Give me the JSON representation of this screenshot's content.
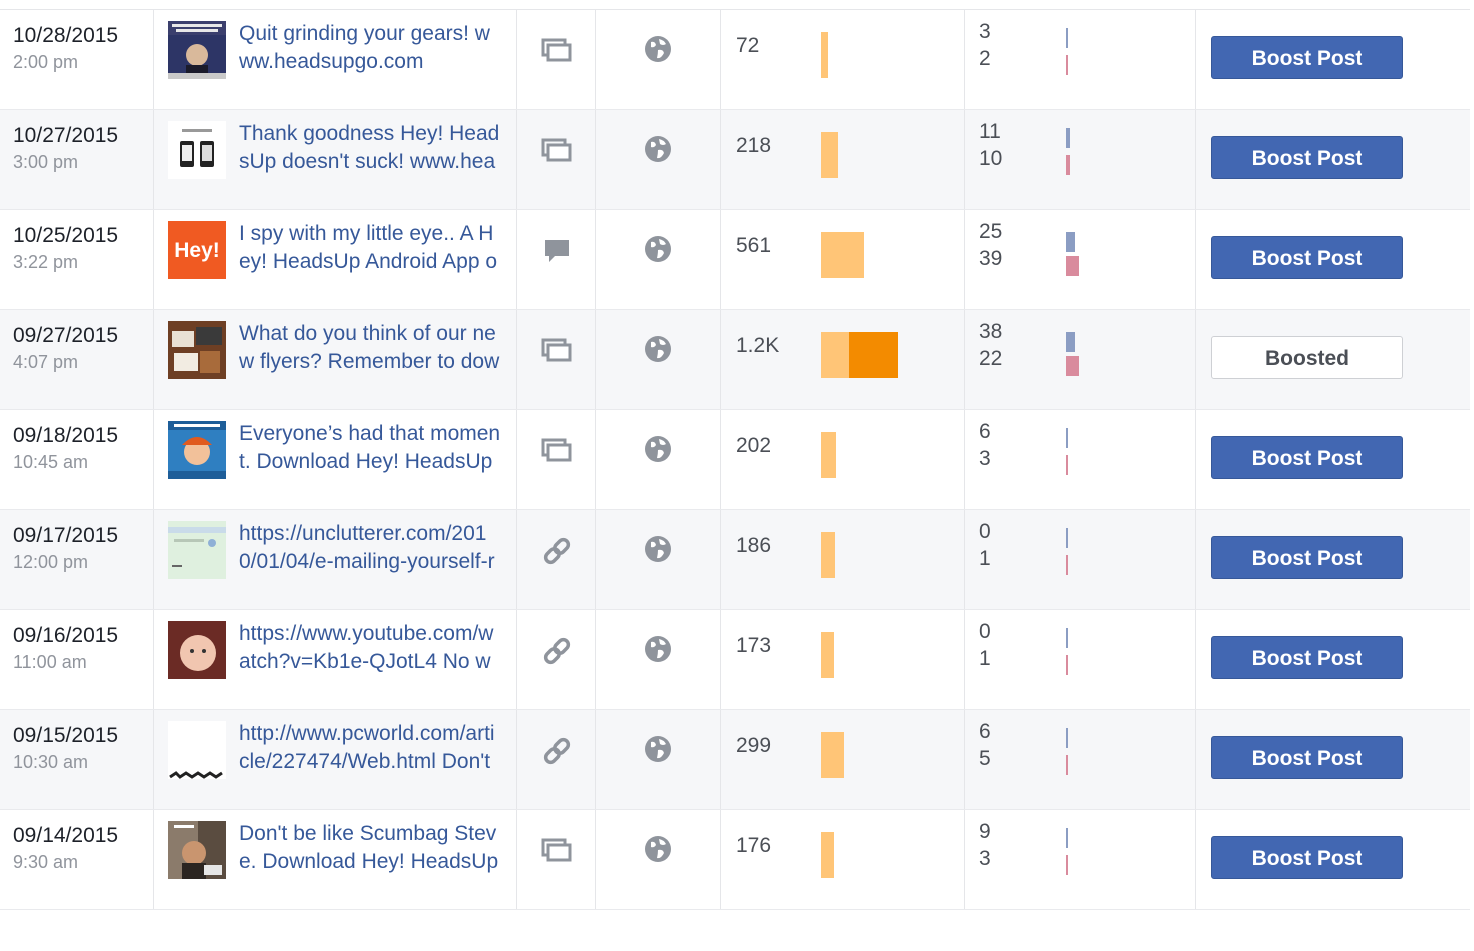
{
  "colors": {
    "link": "#365899",
    "boost_button": "#4267b2",
    "reach_organic": "#ffc577",
    "reach_paid": "#f38b00",
    "engagement_top": "#8b9dc3",
    "engagement_bottom": "#d98b9d"
  },
  "posts": [
    {
      "date": "10/28/2015",
      "time": "2:00 pm",
      "thumb": "meme-dark-thumbnail",
      "line1": "Quit grinding your gears! w",
      "line2": "ww.headsupgo.com",
      "type_icon": "album-icon",
      "target_icon": "globe-icon",
      "reach": "72",
      "reach_organic": 72,
      "reach_paid": 0,
      "eng_top": "3",
      "eng_bottom": "2",
      "eng_top_val": 3,
      "eng_bottom_val": 2,
      "button": "Boost Post",
      "boosted": false
    },
    {
      "date": "10/27/2015",
      "time": "3:00 pm",
      "thumb": "phones-thumbnail",
      "line1": "Thank goodness Hey! Head",
      "line2": "sUp doesn't suck! www.hea",
      "type_icon": "album-icon",
      "target_icon": "globe-icon",
      "reach": "218",
      "reach_organic": 218,
      "reach_paid": 0,
      "eng_top": "11",
      "eng_bottom": "10",
      "eng_top_val": 11,
      "eng_bottom_val": 10,
      "button": "Boost Post",
      "boosted": false
    },
    {
      "date": "10/25/2015",
      "time": "3:22 pm",
      "thumb": "hey-logo-thumbnail",
      "thumb_text": "Hey!",
      "line1": "I spy with my little eye.. A H",
      "line2": "ey! HeadsUp Android App o",
      "type_icon": "status-icon",
      "target_icon": "globe-icon",
      "reach": "561",
      "reach_organic": 561,
      "reach_paid": 0,
      "eng_top": "25",
      "eng_bottom": "39",
      "eng_top_val": 25,
      "eng_bottom_val": 39,
      "button": "Boost Post",
      "boosted": false
    },
    {
      "date": "09/27/2015",
      "time": "4:07 pm",
      "thumb": "flyers-thumbnail",
      "line1": "What do you think of our ne",
      "line2": "w flyers? Remember to dow",
      "type_icon": "album-icon",
      "target_icon": "globe-icon",
      "reach": "1.2K",
      "reach_organic": 430,
      "reach_paid": 770,
      "eng_top": "38",
      "eng_bottom": "22",
      "eng_top_val": 38,
      "eng_bottom_val": 22,
      "button": "Boosted",
      "boosted": true
    },
    {
      "date": "09/18/2015",
      "time": "10:45 am",
      "thumb": "fry-meme-thumbnail",
      "line1": "Everyone’s had that momen",
      "line2": "t. Download Hey! HeadsUp",
      "type_icon": "album-icon",
      "target_icon": "globe-icon",
      "reach": "202",
      "reach_organic": 202,
      "reach_paid": 0,
      "eng_top": "6",
      "eng_bottom": "3",
      "eng_top_val": 6,
      "eng_bottom_val": 3,
      "button": "Boost Post",
      "boosted": false
    },
    {
      "date": "09/17/2015",
      "time": "12:00 pm",
      "thumb": "webpage-thumbnail",
      "line1": "https://unclutterer.com/201",
      "line2": "0/01/04/e-mailing-yourself-r",
      "type_icon": "link-icon",
      "target_icon": "globe-icon",
      "reach": "186",
      "reach_organic": 186,
      "reach_paid": 0,
      "eng_top": "0",
      "eng_bottom": "1",
      "eng_top_val": 0,
      "eng_bottom_val": 1,
      "button": "Boost Post",
      "boosted": false
    },
    {
      "date": "09/16/2015",
      "time": "11:00 am",
      "thumb": "baby-thumbnail",
      "line1": "https://www.youtube.com/w",
      "line2": "atch?v=Kb1e-QJotL4 No w",
      "type_icon": "link-icon",
      "target_icon": "globe-icon",
      "reach": "173",
      "reach_organic": 173,
      "reach_paid": 0,
      "eng_top": "0",
      "eng_bottom": "1",
      "eng_top_val": 0,
      "eng_bottom_val": 1,
      "button": "Boost Post",
      "boosted": false
    },
    {
      "date": "09/15/2015",
      "time": "10:30 am",
      "thumb": "pcworld-thumbnail",
      "line1": "http://www.pcworld.com/arti",
      "line2": "cle/227474/Web.html Don't",
      "type_icon": "link-icon",
      "target_icon": "globe-icon",
      "reach": "299",
      "reach_organic": 299,
      "reach_paid": 0,
      "eng_top": "6",
      "eng_bottom": "5",
      "eng_top_val": 6,
      "eng_bottom_val": 5,
      "button": "Boost Post",
      "boosted": false
    },
    {
      "date": "09/14/2015",
      "time": "9:30 am",
      "thumb": "scumbag-steve-thumbnail",
      "line1": "Don't be like Scumbag Stev",
      "line2": "e. Download Hey! HeadsUp",
      "type_icon": "album-icon",
      "target_icon": "globe-icon",
      "reach": "176",
      "reach_organic": 176,
      "reach_paid": 0,
      "eng_top": "9",
      "eng_bottom": "3",
      "eng_top_val": 9,
      "eng_bottom_val": 3,
      "button": "Boost Post",
      "boosted": false
    }
  ]
}
